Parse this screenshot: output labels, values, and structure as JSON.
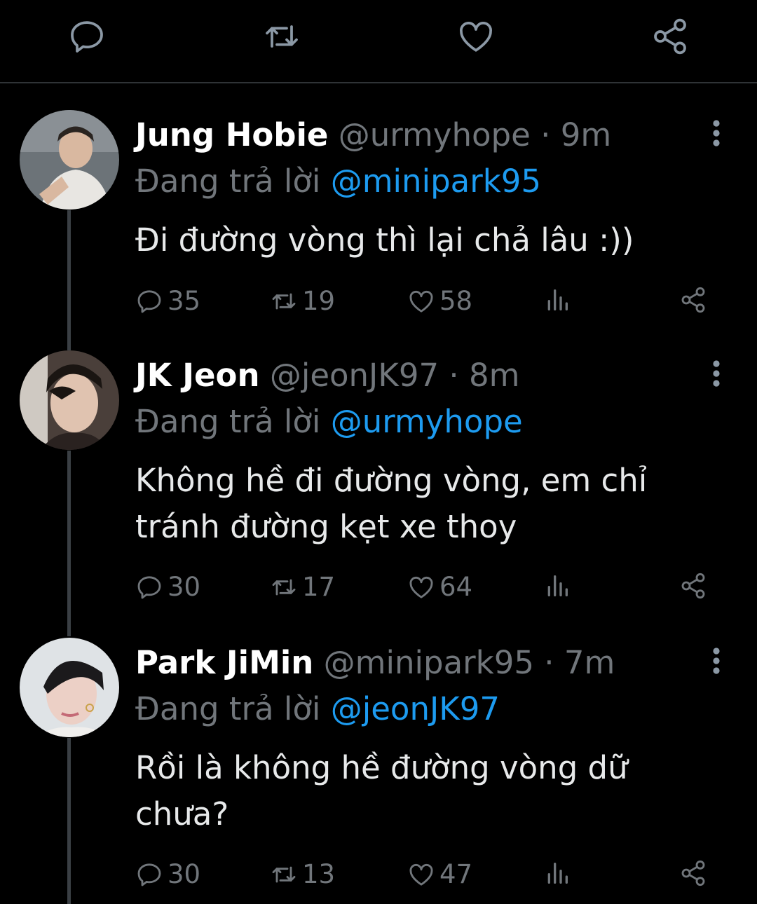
{
  "tweets": [
    {
      "name": "Jung Hobie",
      "handle": "@urmyhope",
      "dot": "·",
      "time": "9m",
      "replying_prefix": "Đang trả lời",
      "replying_to": "@minipark95",
      "text": "Đi đường vòng thì lại chả lâu :))",
      "replies": "35",
      "retweets": "19",
      "likes": "58"
    },
    {
      "name": "JK Jeon",
      "handle": "@jeonJK97",
      "dot": "·",
      "time": "8m",
      "replying_prefix": "Đang trả lời",
      "replying_to": "@urmyhope",
      "text": "Không hề đi đường vòng, em chỉ tránh đường kẹt xe thoy",
      "replies": "30",
      "retweets": "17",
      "likes": "64"
    },
    {
      "name": "Park JiMin",
      "handle": "@minipark95",
      "dot": "·",
      "time": "7m",
      "replying_prefix": "Đang trả lời",
      "replying_to": "@jeonJK97",
      "text": "Rồi là không hề đường vòng dữ chưa?",
      "replies": "30",
      "retweets": "13",
      "likes": "47"
    }
  ],
  "colors": {
    "background": "#000000",
    "text": "#e7e9ea",
    "muted": "#71767b",
    "accent": "#1d9bf0",
    "divider": "#2f3336"
  },
  "icons": [
    "reply-icon",
    "retweet-icon",
    "like-icon",
    "views-icon",
    "share-icon",
    "more-icon"
  ]
}
